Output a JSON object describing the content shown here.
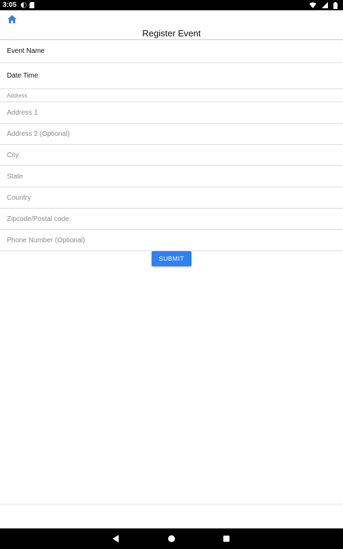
{
  "status_bar": {
    "time": "3:05",
    "icons": [
      "notification-app-icon",
      "sd-card-icon",
      "wifi-icon",
      "cellular-signal-icon",
      "battery-icon"
    ]
  },
  "header": {
    "home_icon": "home-icon",
    "title": "Register Event"
  },
  "form": {
    "event_name_label": "Event Name",
    "datetime_label": "Date Time",
    "address_section_label": "Address",
    "fields": {
      "address1": {
        "value": "",
        "placeholder": "Address 1"
      },
      "address2": {
        "value": "",
        "placeholder": "Address 2 (Optional)"
      },
      "city": {
        "value": "",
        "placeholder": "City"
      },
      "state": {
        "value": "",
        "placeholder": "State"
      },
      "country": {
        "value": "",
        "placeholder": "Country"
      },
      "zipcode": {
        "value": "",
        "placeholder": "Zipcode/Postal code"
      },
      "phone": {
        "value": "",
        "placeholder": "Phone Number (Optional)"
      }
    },
    "submit_label": "SUBMIT"
  },
  "nav_bar": {
    "icons": [
      "back-icon",
      "home-circle-icon",
      "recents-icon"
    ]
  },
  "colors": {
    "accent": "#2f7ff5",
    "home_icon": "#2f7ff5",
    "status_bar": "#000000",
    "placeholder": "#8a8a8a"
  }
}
